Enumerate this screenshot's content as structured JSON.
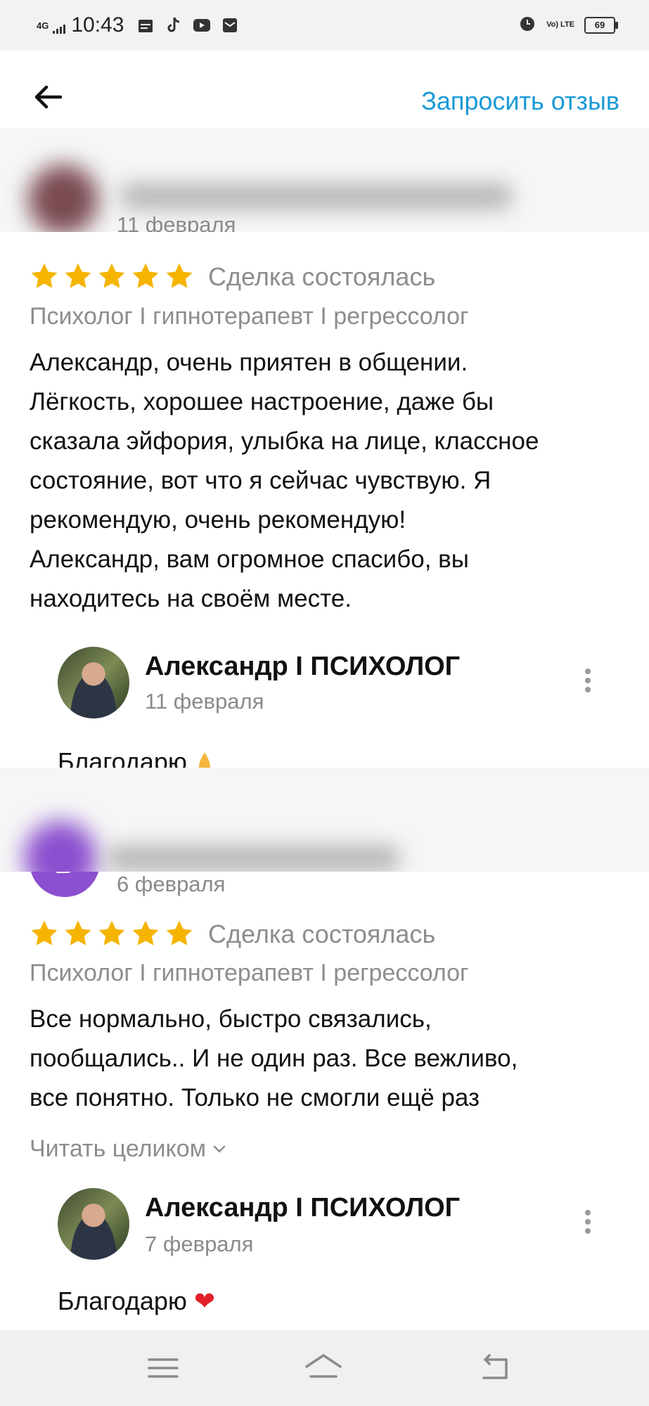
{
  "status_bar": {
    "network": "4G",
    "time": "10:43",
    "volte": "Vo) LTE",
    "battery": "69"
  },
  "toolbar": {
    "request_review": "Запросить отзыв"
  },
  "reviews": [
    {
      "date": "11 февраля",
      "rating": 5,
      "deal_status": "Сделка состоялась",
      "category": "Психолог I гипнотерапевт I регрессолог",
      "lines": [
        "Александр, очень приятен в общении.",
        "Лёгкость, хорошее настроение, даже бы",
        "сказала эйфория, улыбка на лице, классное",
        "состояние,  вот что я сейчас чувствую. Я",
        "рекомендую, очень рекомендую!",
        "Александр, вам огромное спасибо, вы",
        "находитесь на своём месте."
      ],
      "reply": {
        "author": "Александр I ПСИХОЛОГ",
        "date": "11 февраля",
        "text": "Благодарю"
      }
    },
    {
      "avatar_letter": "В",
      "date": "6 февраля",
      "rating": 5,
      "deal_status": "Сделка состоялась",
      "category": "Психолог I гипнотерапевт I регрессолог",
      "lines": [
        "Все нормально, быстро связались,",
        "пообщались.. И не один раз. Все вежливо,",
        "все понятно. Только не смогли ещё раз"
      ],
      "read_more": "Читать целиком",
      "reply": {
        "author": "Александр I ПСИХОЛОГ",
        "date": "7 февраля",
        "text": "Благодарю",
        "emoji": "❤"
      }
    }
  ],
  "colors": {
    "accent": "#1a9ad6",
    "star": "#f5b400",
    "avatar_purple": "#8b4fcf"
  }
}
